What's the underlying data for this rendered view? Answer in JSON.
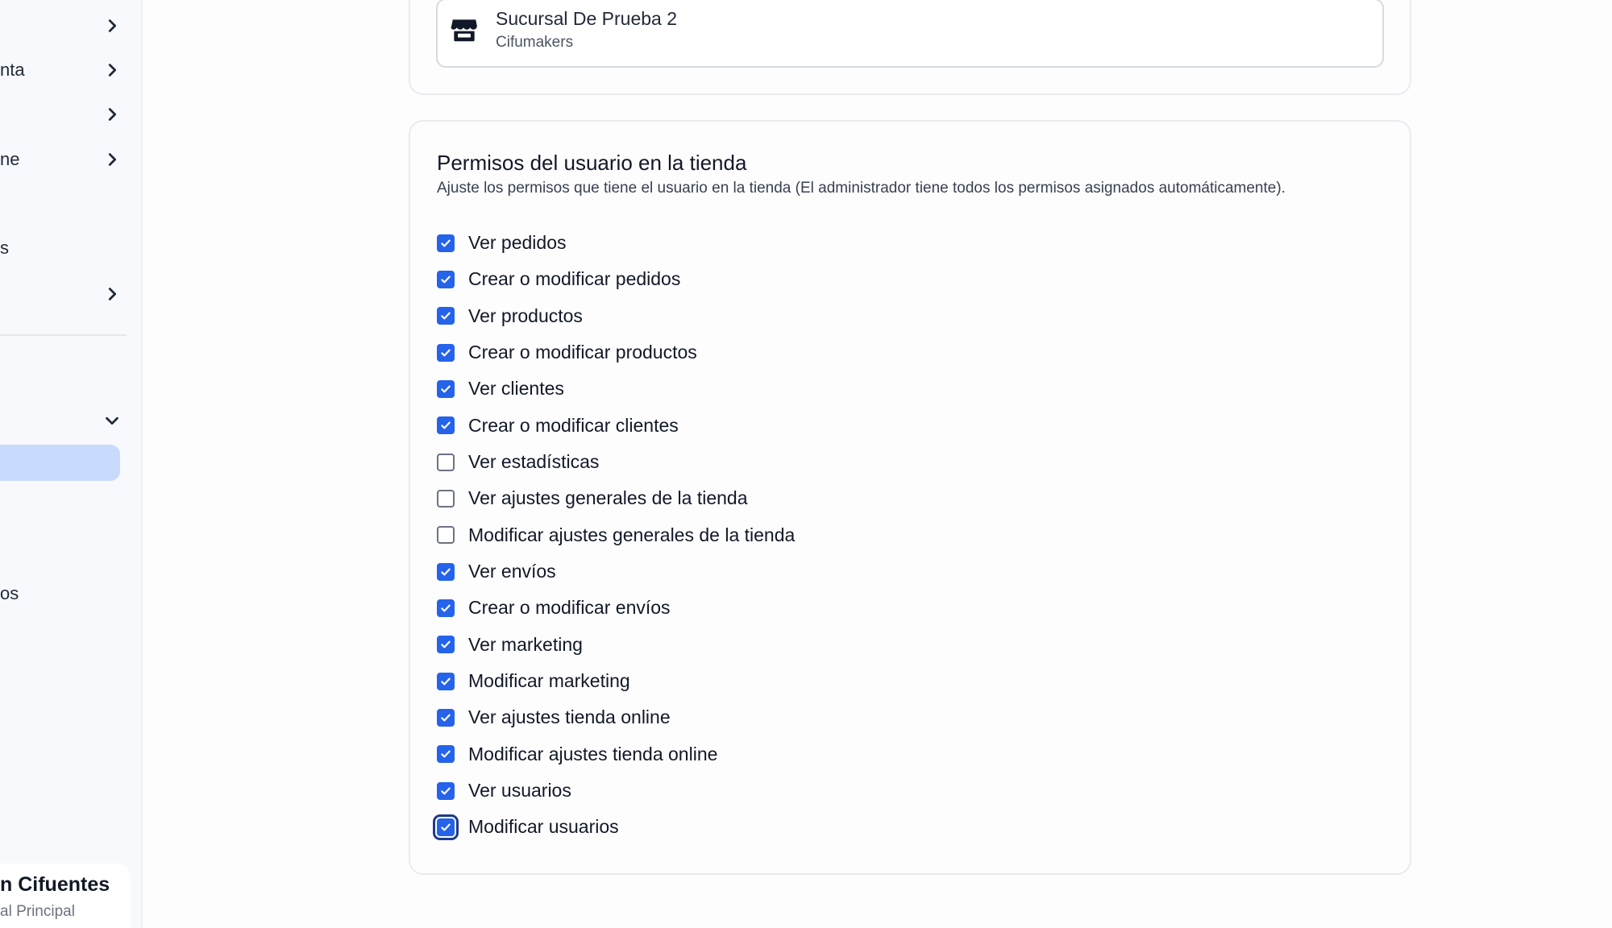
{
  "sidebar": {
    "items": [
      {
        "label": "",
        "chevron": "chevron-right"
      },
      {
        "label": "nta",
        "chevron": "chevron-right"
      },
      {
        "label": "",
        "chevron": "chevron-right"
      },
      {
        "label": "ne",
        "chevron": "chevron-right"
      },
      {
        "label": "s",
        "chevron": ""
      },
      {
        "label": "",
        "chevron": "chevron-right"
      },
      {
        "label": "",
        "chevron": "chevron-down"
      },
      {
        "label": "os",
        "chevron": ""
      }
    ],
    "user": {
      "name": "n Cifuentes",
      "branch": "al Principal"
    }
  },
  "store": {
    "name": "Sucursal De Prueba 2",
    "company": "Cifumakers",
    "icon": "store-icon"
  },
  "permissions": {
    "title": "Permisos del usuario en la tienda",
    "subtitle": "Ajuste los permisos que tiene el usuario en la tienda (El administrador tiene todos los permisos asignados automáticamente).",
    "items": [
      {
        "label": "Ver pedidos",
        "checked": true
      },
      {
        "label": "Crear o modificar pedidos",
        "checked": true
      },
      {
        "label": "Ver productos",
        "checked": true
      },
      {
        "label": "Crear o modificar productos",
        "checked": true
      },
      {
        "label": "Ver clientes",
        "checked": true
      },
      {
        "label": "Crear o modificar clientes",
        "checked": true
      },
      {
        "label": "Ver estadísticas",
        "checked": false
      },
      {
        "label": "Ver ajustes generales de la tienda",
        "checked": false
      },
      {
        "label": "Modificar ajustes generales de la tienda",
        "checked": false
      },
      {
        "label": "Ver envíos",
        "checked": true
      },
      {
        "label": "Crear o modificar envíos",
        "checked": true
      },
      {
        "label": "Ver marketing",
        "checked": true
      },
      {
        "label": "Modificar marketing",
        "checked": true
      },
      {
        "label": "Ver ajustes tienda online",
        "checked": true
      },
      {
        "label": "Modificar ajustes tienda online",
        "checked": true
      },
      {
        "label": "Ver usuarios",
        "checked": true
      },
      {
        "label": "Modificar usuarios",
        "checked": true,
        "focused": true
      }
    ]
  },
  "colors": {
    "accent": "#2563eb",
    "active_nav": "#c9dbfd",
    "sidebar_bg": "#f7f9fc"
  }
}
